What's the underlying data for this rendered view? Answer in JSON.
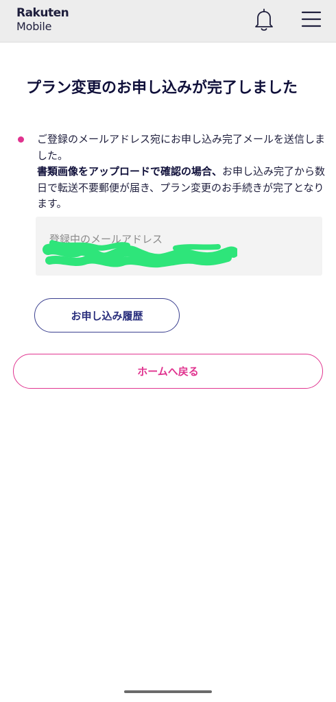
{
  "header": {
    "logo_top": "Rakuten",
    "logo_bottom": "Mobile",
    "bell_icon": "bell-icon",
    "menu_icon": "hamburger-menu-icon"
  },
  "main": {
    "title": "プラン変更のお申し込みが完了しました",
    "notice": {
      "line1": "ご登録のメールアドレス宛にお申し込み完了メールを送信しました。",
      "bold": "書類画像をアップロードで確認の場合、",
      "rest": "お申し込み完了から数日で転送不要郵便が届き、プラン変更のお手続きが完了となります。"
    },
    "email": {
      "label": "登録中のメールアドレス",
      "value": ""
    },
    "history_button": "お申し込み履歴",
    "home_button": "ホームへ戻る"
  },
  "colors": {
    "accent_pink": "#e0338f",
    "navy": "#2a2f7d",
    "header_bg": "#ededed",
    "redaction_green": "#2ee57a"
  }
}
